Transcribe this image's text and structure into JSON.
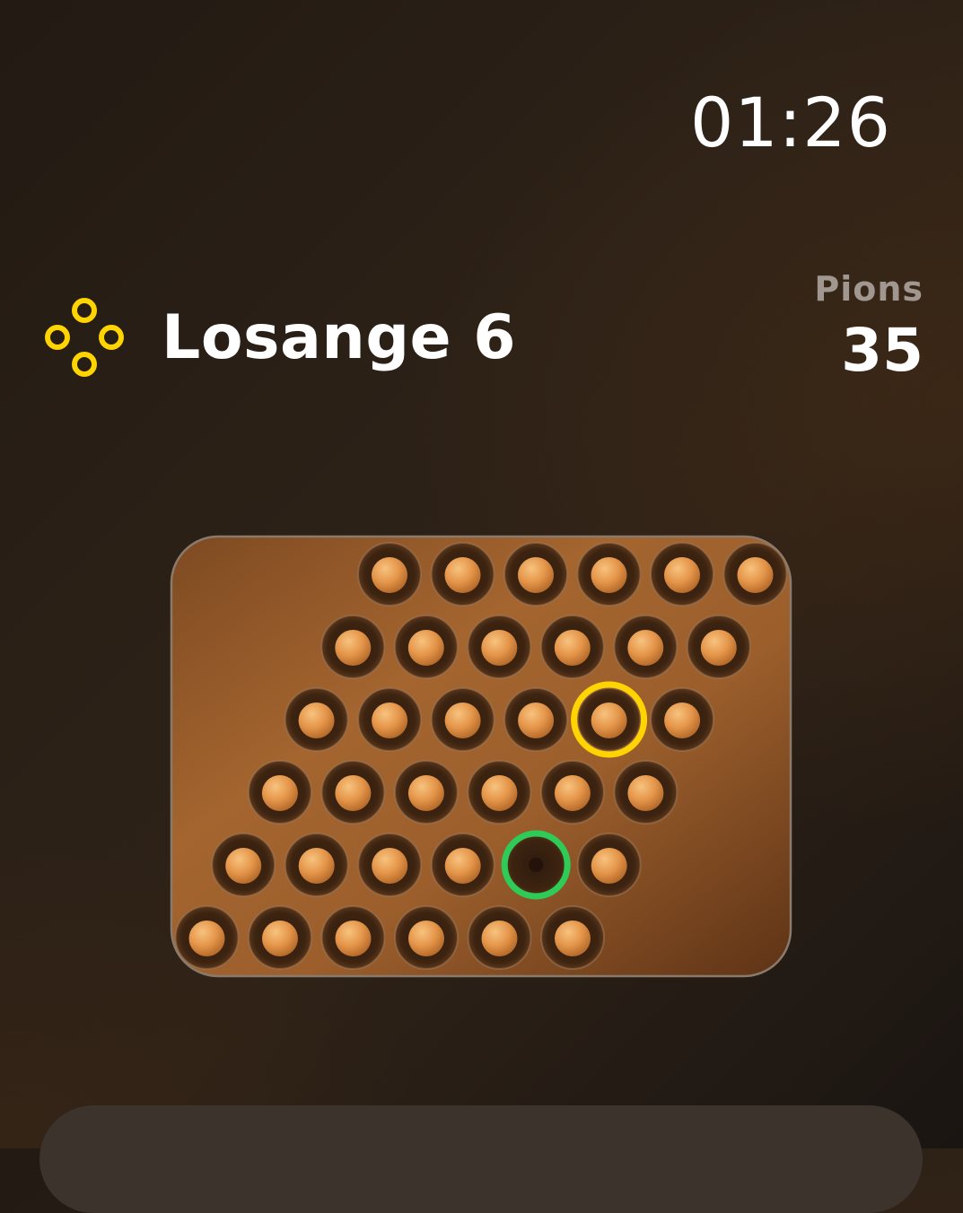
{
  "timer": "01:26",
  "level": {
    "title": "Losange 6",
    "icon": "diamond-rings-icon",
    "icon_color": "#ffd400"
  },
  "stats": {
    "label": "Pions",
    "value": "35"
  },
  "colors": {
    "selected_ring": "#ffd400",
    "target_ring": "#2ecc57",
    "peg": "#e09448"
  },
  "board": {
    "shape": "rhombus",
    "rows": 6,
    "cols": 6,
    "pegs": [
      [
        1,
        1,
        1,
        1,
        1,
        1
      ],
      [
        1,
        1,
        1,
        1,
        1,
        1
      ],
      [
        1,
        1,
        1,
        1,
        1,
        1
      ],
      [
        1,
        1,
        1,
        1,
        1,
        1
      ],
      [
        1,
        1,
        1,
        1,
        0,
        1
      ],
      [
        1,
        1,
        1,
        1,
        1,
        1
      ]
    ],
    "selected": {
      "row": 2,
      "col": 4
    },
    "target": {
      "row": 4,
      "col": 4
    }
  }
}
